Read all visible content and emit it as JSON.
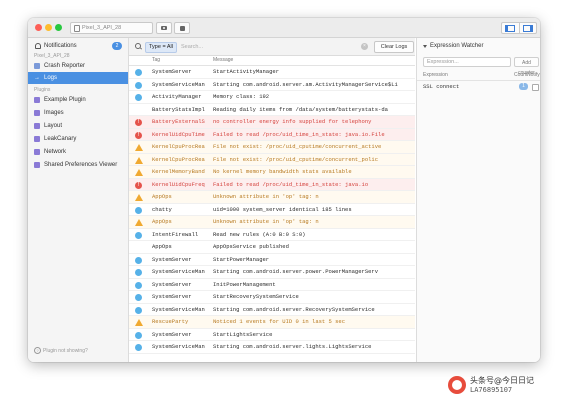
{
  "titlebar": {
    "device_label": "Pixel_3_API_28"
  },
  "sidebar": {
    "notifications": {
      "label": "Notifications",
      "badge": "2"
    },
    "device_group": "Pixel_3_API_28",
    "items": [
      {
        "label": "Crash Reporter"
      },
      {
        "label": "Logs"
      }
    ],
    "plugins_header": "Plugins",
    "plugins": [
      {
        "label": "Example Plugin"
      },
      {
        "label": "Images"
      },
      {
        "label": "Layout"
      },
      {
        "label": "LeakCanary"
      },
      {
        "label": "Network"
      },
      {
        "label": "Shared Preferences Viewer"
      }
    ],
    "footer": "Plugin not showing?"
  },
  "logs": {
    "type_filter": "Type = All",
    "search_placeholder": "Search...",
    "clear_label": "Clear Logs",
    "columns": {
      "tag": "Tag",
      "message": "Message"
    },
    "rows": [
      {
        "level": "info",
        "tag": "SystemServer",
        "message": "StartActivityManager"
      },
      {
        "level": "info",
        "tag": "SystemServiceMan",
        "message": "Starting com.android.server.am.ActivityManagerService$Li"
      },
      {
        "level": "info",
        "tag": "ActivityManager",
        "message": "Memory class: 192"
      },
      {
        "level": "plain",
        "tag": "BatteryStatsImpl",
        "message": "Reading daily items from /data/system/batterystats-da"
      },
      {
        "level": "error",
        "tag": "BatteryExternalS",
        "message": "no controller energy info supplied for telephony"
      },
      {
        "level": "error",
        "tag": "KernelUidCpuTime",
        "message": "Failed to read /proc/uid_time_in_state: java.io.File"
      },
      {
        "level": "warn",
        "tag": "KernelCpuProcRea",
        "message": "File not exist: /proc/uid_cputime/concurrent_active"
      },
      {
        "level": "warn",
        "tag": "KernelCpuProcRea",
        "message": "File not exist: /proc/uid_cputime/concurrent_polic"
      },
      {
        "level": "warn",
        "tag": "KernelMemoryBand",
        "message": "No kernel memory bandwidth stats available"
      },
      {
        "level": "error",
        "tag": "KernelUidCpuFreq",
        "message": "Failed to read /proc/uid_time_in_state: java.io"
      },
      {
        "level": "warn",
        "tag": "AppOps",
        "message": "Unknown attribute in 'op' tag: n"
      },
      {
        "level": "info",
        "tag": "chatty",
        "message": "uid=1000 system_server identical 185 lines"
      },
      {
        "level": "warn",
        "tag": "AppOps",
        "message": "Unknown attribute in 'op' tag: n"
      },
      {
        "level": "info",
        "tag": "IntentFirewall",
        "message": "Read new rules (A:0 B:0 S:0)"
      },
      {
        "level": "plain",
        "tag": "AppOps",
        "message": "AppOpsService published"
      },
      {
        "level": "info",
        "tag": "SystemServer",
        "message": "StartPowerManager"
      },
      {
        "level": "info",
        "tag": "SystemServiceMan",
        "message": "Starting com.android.server.power.PowerManagerServ"
      },
      {
        "level": "info",
        "tag": "SystemServer",
        "message": "InitPowerManagement"
      },
      {
        "level": "info",
        "tag": "SystemServer",
        "message": "StartRecoverySystemService"
      },
      {
        "level": "info",
        "tag": "SystemServiceMan",
        "message": "Starting com.android.server.RecoverySystemService"
      },
      {
        "level": "warn",
        "tag": "RescueParty",
        "message": "Noticed 1 events for UID 0 in last 5 sec"
      },
      {
        "level": "info",
        "tag": "SystemServer",
        "message": "StartLightsService"
      },
      {
        "level": "info",
        "tag": "SystemServiceMan",
        "message": "Starting com.android.server.lights.LightsService"
      }
    ]
  },
  "watcher": {
    "title": "Expression Watcher",
    "input_placeholder": "Expression...",
    "add_label": "Add counter",
    "columns": {
      "expression": "Expression",
      "count": "Count",
      "notify": "Notify"
    },
    "rows": [
      {
        "expression": "SSL connect",
        "count": "1"
      }
    ]
  },
  "watermark": {
    "text": "头条号@今日日记",
    "sub": "LA76895107"
  },
  "colors": {
    "accent": "#4a90e2",
    "error": "#d43f3a",
    "warning": "#b7791f",
    "info_icon": "#56b1e8"
  }
}
